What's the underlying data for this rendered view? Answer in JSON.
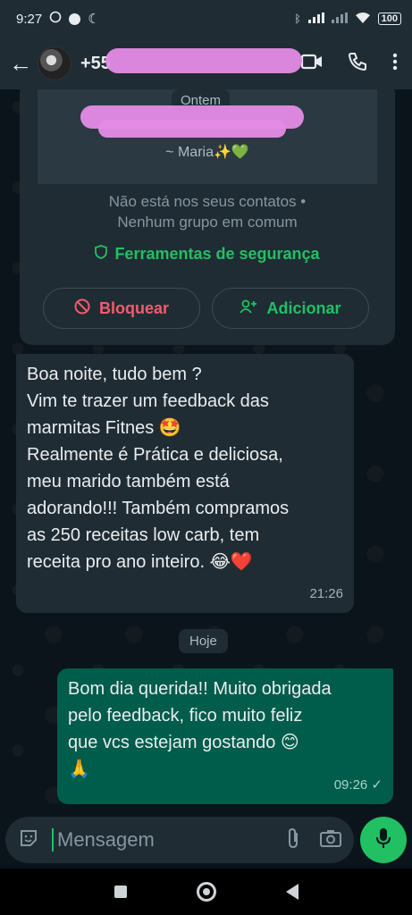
{
  "status_bar": {
    "time": "9:27",
    "battery": "100"
  },
  "header": {
    "contact_prefix": "+55"
  },
  "info_card": {
    "date_chip": "Ontem",
    "signature": "~ Maria✨💚",
    "not_in_contacts": "Não está nos seus contatos •",
    "no_groups": "Nenhum grupo em comum",
    "security_tools": "Ferramentas de segurança",
    "block_label": "Bloquear",
    "add_label": "Adicionar"
  },
  "messages": [
    {
      "direction": "incoming",
      "lines": [
        "Boa noite, tudo bem ?",
        "Vim te trazer um feedback das",
        "marmitas Fitnes 🤩",
        "Realmente é Prática e deliciosa,",
        "meu marido também está",
        "adorando!!! Também compramos",
        "as 250 receitas low carb, tem",
        "receita pro ano inteiro. 😂❤️"
      ],
      "time": "21:26"
    },
    {
      "direction": "outgoing",
      "lines": [
        "Bom dia querida!! Muito obrigada",
        "pelo feedback, fico muito feliz",
        "que vcs estejam gostando 😊",
        "🙏"
      ],
      "time": "09:26 ✓"
    }
  ],
  "date_separator": "Hoje",
  "composer": {
    "placeholder": "Mensagem"
  },
  "colors": {
    "accent": "#21c063",
    "outgoing_bubble": "#005c4b",
    "incoming_bubble": "#202c33",
    "danger": "#f15c6d"
  }
}
